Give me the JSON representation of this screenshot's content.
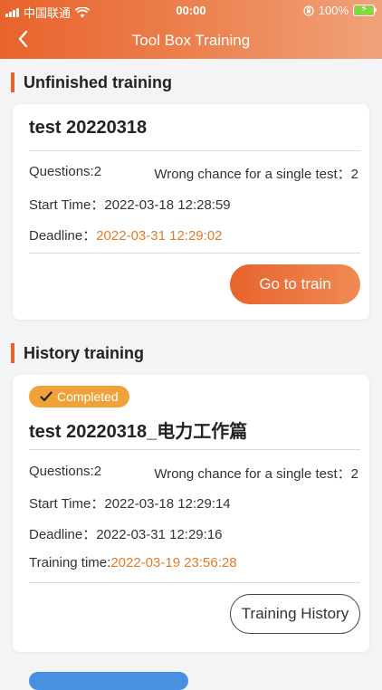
{
  "status_bar": {
    "carrier": "中国联通",
    "time": "00:00",
    "battery": "100%"
  },
  "nav": {
    "title": "Tool Box Training"
  },
  "unfinished": {
    "section_title": "Unfinished training",
    "card": {
      "title": "test 20220318",
      "questions": "Questions:2",
      "wrong_chance": "Wrong chance for a single test：2",
      "start_label": "Start Time：",
      "start_value": "2022-03-18 12:28:59",
      "deadline_label": "Deadline：",
      "deadline_value": "2022-03-31 12:29:02",
      "button": "Go to train"
    }
  },
  "history": {
    "section_title": "History training",
    "card": {
      "badge": "Completed",
      "title": "test 20220318_电力工作篇",
      "questions": "Questions:2",
      "wrong_chance": "Wrong chance for a single test：2",
      "start_label": "Start Time：",
      "start_value": "2022-03-18 12:29:14",
      "deadline_label": "Deadline：",
      "deadline_value": "2022-03-31 12:29:16",
      "training_label": "Training time:",
      "training_value": "2022-03-19 23:56:28",
      "button": "Training History"
    }
  },
  "colors": {
    "accent": "#e8632c",
    "highlight_text": "#e07b2a",
    "badge": "#f0a238"
  }
}
